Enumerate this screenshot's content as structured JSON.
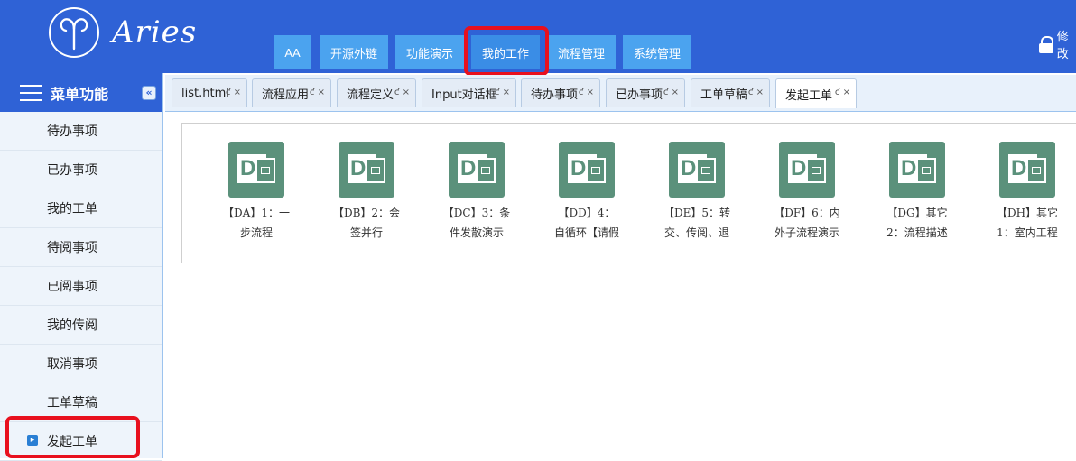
{
  "header": {
    "logo_text": "Aries",
    "nav": [
      "AA",
      "开源外链",
      "功能演示",
      "我的工作",
      "流程管理",
      "系统管理"
    ],
    "active_nav": "我的工作",
    "top_right_label": "修改"
  },
  "sidebar": {
    "title": "菜单功能",
    "collapse_icon": "«",
    "items": [
      {
        "label": "待办事项"
      },
      {
        "label": "已办事项"
      },
      {
        "label": "我的工单"
      },
      {
        "label": "待阅事项"
      },
      {
        "label": "已阅事项"
      },
      {
        "label": "我的传阅"
      },
      {
        "label": "取消事项"
      },
      {
        "label": "工单草稿"
      },
      {
        "label": "发起工单"
      }
    ],
    "active_item": "发起工单"
  },
  "tabs": {
    "items": [
      {
        "label": "list.html"
      },
      {
        "label": "流程应用"
      },
      {
        "label": "流程定义"
      },
      {
        "label": "Input对话框"
      },
      {
        "label": "待办事项"
      },
      {
        "label": "已办事项"
      },
      {
        "label": "工单草稿"
      },
      {
        "label": "发起工单"
      }
    ],
    "active": "发起工单",
    "refresh_glyph": "ƈ",
    "close_glyph": "×"
  },
  "workflows": [
    {
      "line1": "【DA】1：一",
      "line2": "步流程"
    },
    {
      "line1": "【DB】2：会",
      "line2": "签并行"
    },
    {
      "line1": "【DC】3：条",
      "line2": "件发散演示"
    },
    {
      "line1": "【DD】4：",
      "line2": "自循环【请假"
    },
    {
      "line1": "【DE】5：转",
      "line2": "交、传阅、退"
    },
    {
      "line1": "【DF】6：内",
      "line2": "外子流程演示"
    },
    {
      "line1": "【DG】其它",
      "line2": "2：流程描述"
    },
    {
      "line1": "【DH】其它",
      "line2": "1：室内工程"
    }
  ],
  "workflow_icon": "visio-icon",
  "icon_letter": "D",
  "colors": {
    "header_bg": "#2f62d6",
    "nav_btn": "#4ba3ef",
    "highlight": "#e8101e",
    "icon_bg": "#5b917b"
  }
}
